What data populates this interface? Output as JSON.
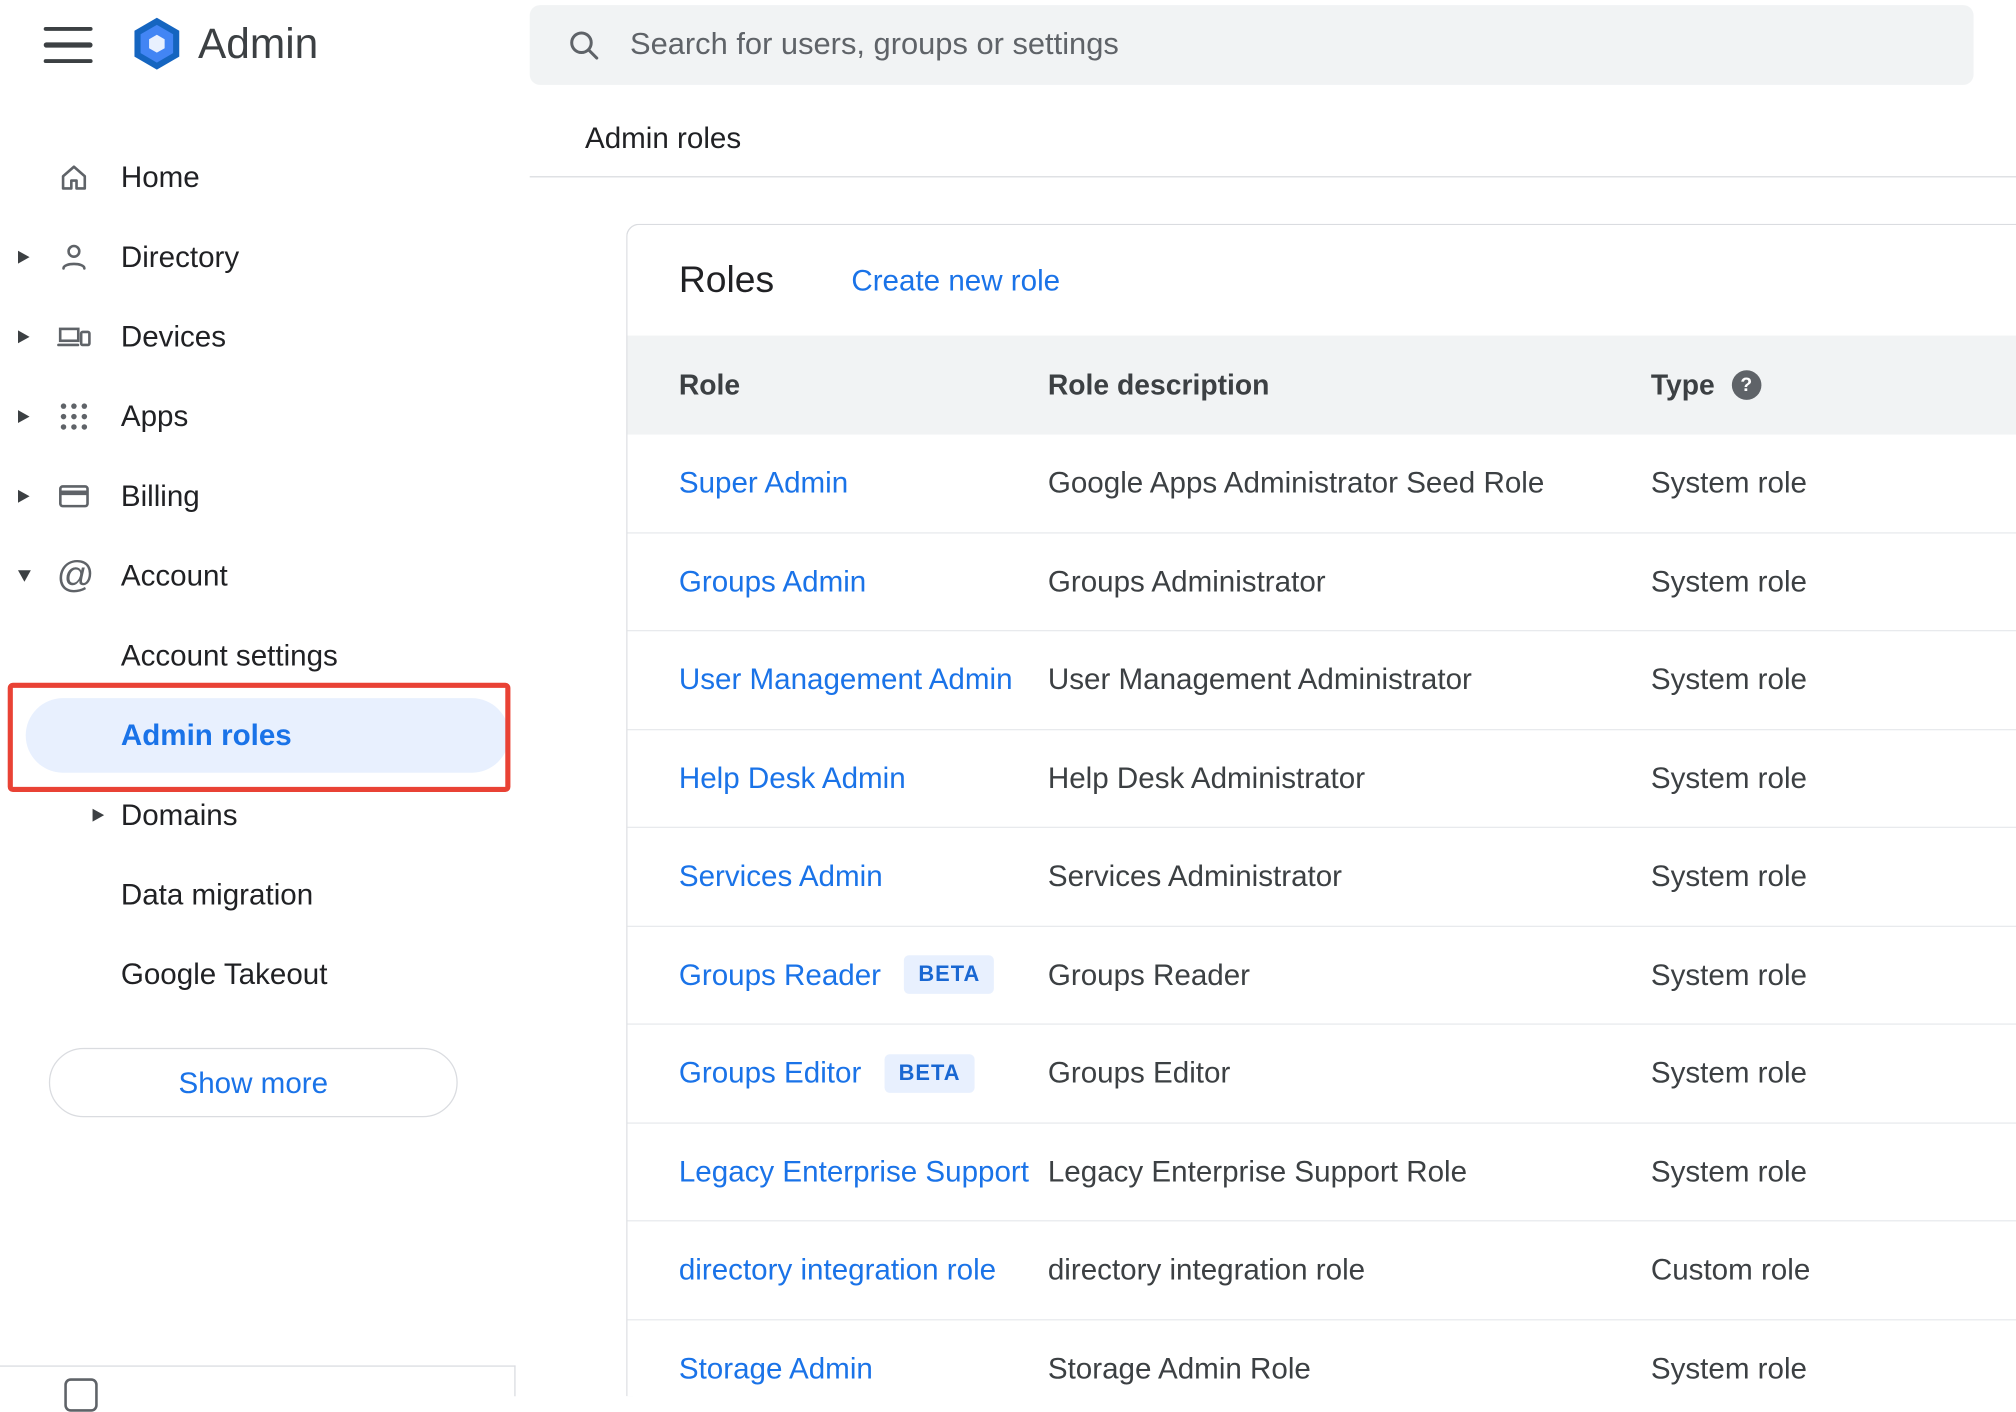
{
  "topbar": {
    "app_name": "Admin",
    "search_placeholder": "Search for users, groups or settings"
  },
  "breadcrumb": "Admin roles",
  "sidebar": {
    "items": [
      {
        "label": "Home"
      },
      {
        "label": "Directory"
      },
      {
        "label": "Devices"
      },
      {
        "label": "Apps"
      },
      {
        "label": "Billing"
      },
      {
        "label": "Account"
      }
    ],
    "account_subitems": [
      {
        "label": "Account settings"
      },
      {
        "label": "Admin roles"
      },
      {
        "label": "Domains"
      },
      {
        "label": "Data migration"
      },
      {
        "label": "Google Takeout"
      }
    ],
    "show_more_label": "Show more"
  },
  "main": {
    "title": "Roles",
    "create_link": "Create new role",
    "table": {
      "columns": [
        "Role",
        "Role description",
        "Type"
      ],
      "beta_label": "BETA",
      "rows": [
        {
          "role": "Super Admin",
          "beta": false,
          "description": "Google Apps Administrator Seed Role",
          "type": "System role"
        },
        {
          "role": "Groups Admin",
          "beta": false,
          "description": "Groups Administrator",
          "type": "System role"
        },
        {
          "role": "User Management Admin",
          "beta": false,
          "description": "User Management Administrator",
          "type": "System role"
        },
        {
          "role": "Help Desk Admin",
          "beta": false,
          "description": "Help Desk Administrator",
          "type": "System role"
        },
        {
          "role": "Services Admin",
          "beta": false,
          "description": "Services Administrator",
          "type": "System role"
        },
        {
          "role": "Groups Reader",
          "beta": true,
          "description": "Groups Reader",
          "type": "System role"
        },
        {
          "role": "Groups Editor",
          "beta": true,
          "description": "Groups Editor",
          "type": "System role"
        },
        {
          "role": "Legacy Enterprise Support",
          "beta": false,
          "description": "Legacy Enterprise Support Role",
          "type": "System role"
        },
        {
          "role": "directory integration role",
          "beta": false,
          "description": "directory integration role",
          "type": "Custom role"
        },
        {
          "role": "Storage Admin",
          "beta": false,
          "description": "Storage Admin Role",
          "type": "System role"
        }
      ]
    }
  },
  "icons": {
    "hamburger-menu": "三bars",
    "search": "magnifier",
    "home": "house-outline",
    "directory": "person-outline",
    "devices": "laptop-phone-outline",
    "apps": "3x3-dot-grid",
    "billing": "credit-card-outline",
    "account": "@",
    "help": "?",
    "expand-arrow": "▸",
    "collapse-arrow": "▾"
  },
  "colors": {
    "accent": "#1a73e8",
    "selected-bg": "#e8f0fe",
    "annotation-red": "#e94235",
    "badge-bg": "#e8f0fe",
    "badge-text": "#1967d2",
    "searchbar-bg": "#f1f3f4",
    "table-header-bg": "#f1f3f4",
    "border": "#dadce0"
  }
}
